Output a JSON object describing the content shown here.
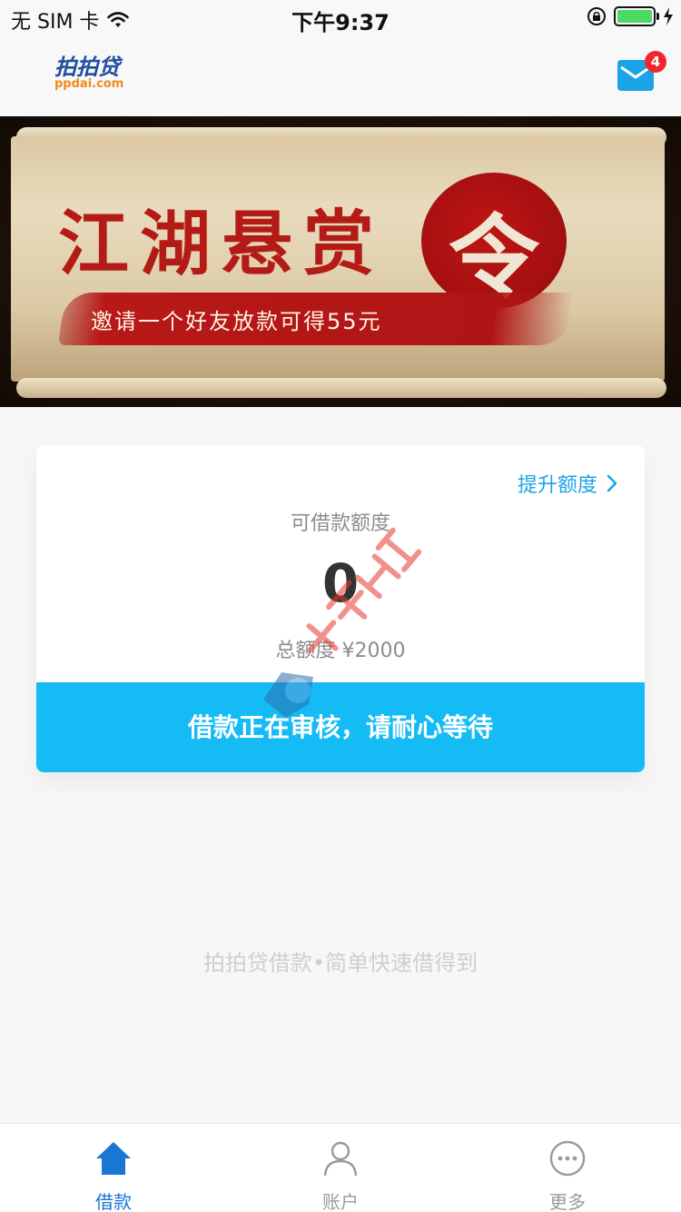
{
  "status_bar": {
    "carrier": "无 SIM 卡",
    "time": "下午9:37"
  },
  "header": {
    "logo_cn": "拍拍贷",
    "logo_en": "ppdai.com",
    "mail_badge_count": "4",
    "mail_icon": "mail-icon"
  },
  "banner": {
    "title": "江湖悬赏",
    "seal_char": "令",
    "subtitle": "邀请一个好友放款可得55元",
    "colors": {
      "red": "#b41b17",
      "paper": "#e8dbbd"
    }
  },
  "card": {
    "raise_limit_label": "提升额度",
    "available_label": "可借款额度",
    "available_amount": "0",
    "total_label": "总额度 ¥2000",
    "status_button": "借款正在审核，请耐心等待",
    "accent": "#14bbf5"
  },
  "slogan": "拍拍贷借款•简单快速借得到",
  "tabs": [
    {
      "label": "借款",
      "icon": "home-icon",
      "active": true
    },
    {
      "label": "账户",
      "icon": "user-icon",
      "active": false
    },
    {
      "label": "更多",
      "icon": "more-icon",
      "active": false
    }
  ]
}
